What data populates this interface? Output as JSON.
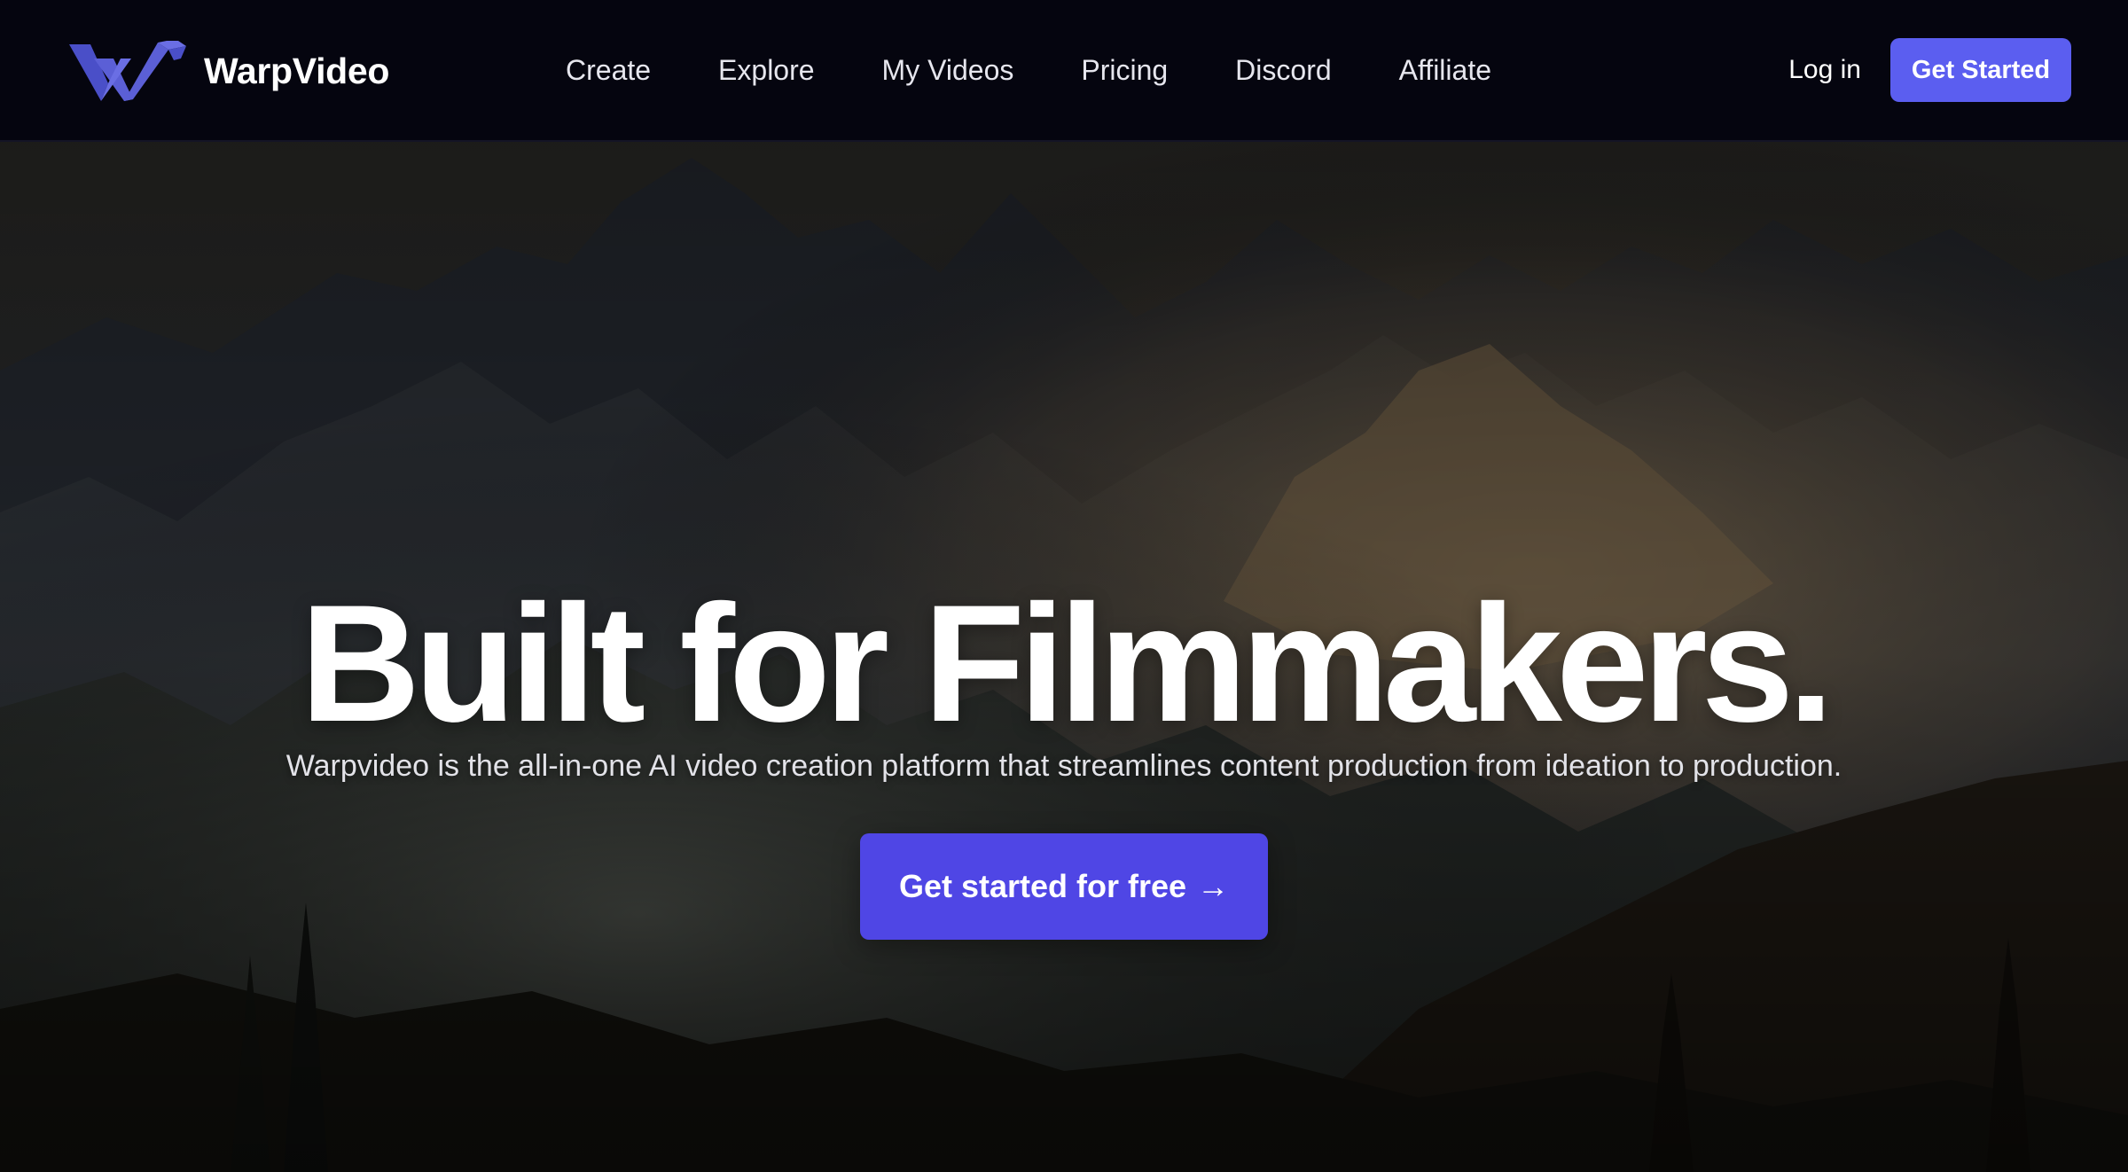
{
  "brand": {
    "name": "WarpVideo",
    "logo_icon": "warp-w-logo-icon",
    "accent_color": "#5b5ef0"
  },
  "nav": {
    "links": [
      "Create",
      "Explore",
      "My Videos",
      "Pricing",
      "Discord",
      "Affiliate"
    ],
    "login_label": "Log in",
    "get_started_label": "Get Started"
  },
  "hero": {
    "title": "Built for Filmmakers.",
    "subtitle": "Warpvideo is the all-in-one AI video creation platform that streamlines content production from ideation to production.",
    "cta_label": "Get started for free",
    "cta_arrow": "→",
    "cta_color": "#4f46e5",
    "background_icon": "misty-mountains-image"
  }
}
